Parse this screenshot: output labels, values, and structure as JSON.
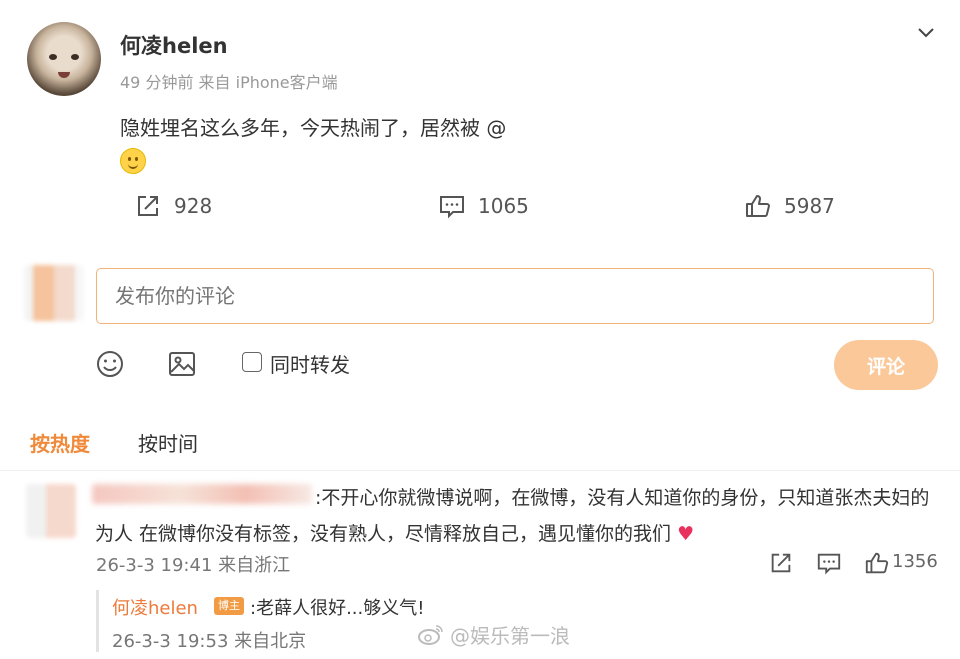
{
  "post": {
    "username": "何凌helen",
    "meta": "49 分钟前  来自 iPhone客户端",
    "text": "隐姓埋名这么多年，今天热闹了，居然被 @",
    "stats": {
      "repost": "928",
      "comment": "1065",
      "like": "5987"
    }
  },
  "composer": {
    "placeholder": "发布你的评论",
    "also_repost": "同时转发",
    "submit": "评论"
  },
  "sort_tabs": {
    "hot": "按热度",
    "time": "按时间"
  },
  "comment": {
    "text": ":不开心你就微博说啊，在微博，没有人知道你的身份，只知道张杰夫妇的为人   在微博你没有标签，没有熟人，尽情释放自己，遇见懂你的我们",
    "heart": "♥",
    "time": "26-3-3 19:41 来自浙江",
    "likes": "1356",
    "reply": {
      "name": "何凌helen",
      "badge": "博主",
      "text": ":老薛人很好...够义气!",
      "time": "26-3-3 19:53 来自北京"
    }
  },
  "watermark": "@娱乐第一浪",
  "colors": {
    "accent": "#f08a3a",
    "submit_bg": "#fbc89a",
    "input_border": "#f2b27a"
  }
}
